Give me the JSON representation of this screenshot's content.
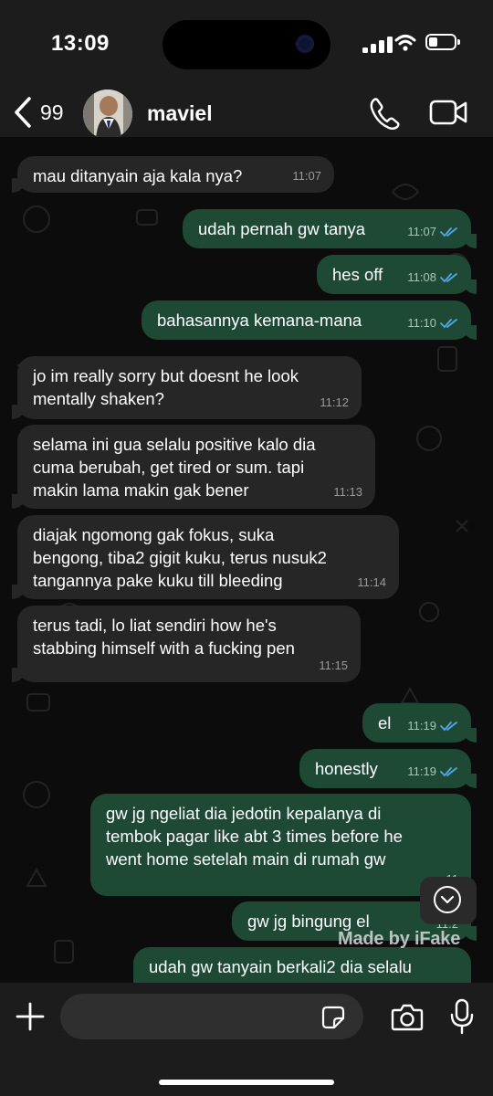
{
  "status_bar": {
    "time": "13:09"
  },
  "header": {
    "back_count": "99",
    "contact_name": "maviel"
  },
  "messages": [
    {
      "dir": "in",
      "text": "mau ditanyain aja kala nya?",
      "time": "11:07"
    },
    {
      "dir": "out",
      "text": "udah pernah gw tanya",
      "time": "11:07",
      "read": true
    },
    {
      "dir": "out",
      "text": "hes off",
      "time": "11:08",
      "read": true
    },
    {
      "dir": "out",
      "text": "bahasannya kemana-mana",
      "time": "11:10",
      "read": true
    },
    {
      "dir": "in",
      "text": "jo im really sorry but doesnt he look\nmentally shaken?",
      "time": "11:12"
    },
    {
      "dir": "in",
      "text": "selama ini gua selalu positive kalo dia\ncuma berubah, get tired or sum. tapi\nmakin lama makin gak bener",
      "time": "11:13"
    },
    {
      "dir": "in",
      "text": "diajak ngomong gak fokus, suka\nbengong, tiba2 gigit kuku, terus nusuk2\ntangannya pake kuku till bleeding",
      "time": "11:14"
    },
    {
      "dir": "in",
      "text": "terus tadi, lo liat sendiri how he's\nstabbing himself with a fucking pen",
      "time": "11:15"
    },
    {
      "dir": "out",
      "text": "el",
      "time": "11:19",
      "read": true
    },
    {
      "dir": "out",
      "text": "honestly",
      "time": "11:19",
      "read": true
    },
    {
      "dir": "out",
      "text": "gw jg ngeliat dia jedotin kepalanya di\ntembok pagar like abt 3 times before he\nwent home setelah main di rumah gw",
      "time": "11"
    },
    {
      "dir": "out",
      "text": "gw jg bingung el",
      "time": "11:2"
    },
    {
      "dir": "out",
      "text": "udah gw tanyain berkali2 dia selalu",
      "time": ""
    }
  ],
  "watermark": "Made by iFake",
  "input_bar": {
    "placeholder": ""
  },
  "colors": {
    "incoming_bubble": "#262626",
    "outgoing_bubble": "#1e4a35",
    "read_tick": "#53a6e8"
  }
}
